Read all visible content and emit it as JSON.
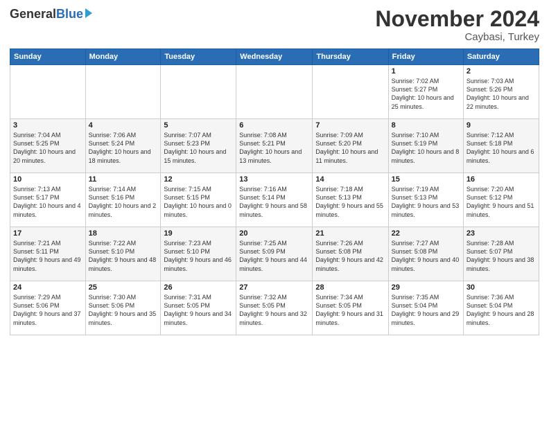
{
  "header": {
    "logo_general": "General",
    "logo_blue": "Blue",
    "month_title": "November 2024",
    "location": "Caybasi, Turkey"
  },
  "days_of_week": [
    "Sunday",
    "Monday",
    "Tuesday",
    "Wednesday",
    "Thursday",
    "Friday",
    "Saturday"
  ],
  "weeks": [
    [
      {
        "day": "",
        "info": ""
      },
      {
        "day": "",
        "info": ""
      },
      {
        "day": "",
        "info": ""
      },
      {
        "day": "",
        "info": ""
      },
      {
        "day": "",
        "info": ""
      },
      {
        "day": "1",
        "info": "Sunrise: 7:02 AM\nSunset: 5:27 PM\nDaylight: 10 hours and 25 minutes."
      },
      {
        "day": "2",
        "info": "Sunrise: 7:03 AM\nSunset: 5:26 PM\nDaylight: 10 hours and 22 minutes."
      }
    ],
    [
      {
        "day": "3",
        "info": "Sunrise: 7:04 AM\nSunset: 5:25 PM\nDaylight: 10 hours and 20 minutes."
      },
      {
        "day": "4",
        "info": "Sunrise: 7:06 AM\nSunset: 5:24 PM\nDaylight: 10 hours and 18 minutes."
      },
      {
        "day": "5",
        "info": "Sunrise: 7:07 AM\nSunset: 5:23 PM\nDaylight: 10 hours and 15 minutes."
      },
      {
        "day": "6",
        "info": "Sunrise: 7:08 AM\nSunset: 5:21 PM\nDaylight: 10 hours and 13 minutes."
      },
      {
        "day": "7",
        "info": "Sunrise: 7:09 AM\nSunset: 5:20 PM\nDaylight: 10 hours and 11 minutes."
      },
      {
        "day": "8",
        "info": "Sunrise: 7:10 AM\nSunset: 5:19 PM\nDaylight: 10 hours and 8 minutes."
      },
      {
        "day": "9",
        "info": "Sunrise: 7:12 AM\nSunset: 5:18 PM\nDaylight: 10 hours and 6 minutes."
      }
    ],
    [
      {
        "day": "10",
        "info": "Sunrise: 7:13 AM\nSunset: 5:17 PM\nDaylight: 10 hours and 4 minutes."
      },
      {
        "day": "11",
        "info": "Sunrise: 7:14 AM\nSunset: 5:16 PM\nDaylight: 10 hours and 2 minutes."
      },
      {
        "day": "12",
        "info": "Sunrise: 7:15 AM\nSunset: 5:15 PM\nDaylight: 10 hours and 0 minutes."
      },
      {
        "day": "13",
        "info": "Sunrise: 7:16 AM\nSunset: 5:14 PM\nDaylight: 9 hours and 58 minutes."
      },
      {
        "day": "14",
        "info": "Sunrise: 7:18 AM\nSunset: 5:13 PM\nDaylight: 9 hours and 55 minutes."
      },
      {
        "day": "15",
        "info": "Sunrise: 7:19 AM\nSunset: 5:13 PM\nDaylight: 9 hours and 53 minutes."
      },
      {
        "day": "16",
        "info": "Sunrise: 7:20 AM\nSunset: 5:12 PM\nDaylight: 9 hours and 51 minutes."
      }
    ],
    [
      {
        "day": "17",
        "info": "Sunrise: 7:21 AM\nSunset: 5:11 PM\nDaylight: 9 hours and 49 minutes."
      },
      {
        "day": "18",
        "info": "Sunrise: 7:22 AM\nSunset: 5:10 PM\nDaylight: 9 hours and 48 minutes."
      },
      {
        "day": "19",
        "info": "Sunrise: 7:23 AM\nSunset: 5:10 PM\nDaylight: 9 hours and 46 minutes."
      },
      {
        "day": "20",
        "info": "Sunrise: 7:25 AM\nSunset: 5:09 PM\nDaylight: 9 hours and 44 minutes."
      },
      {
        "day": "21",
        "info": "Sunrise: 7:26 AM\nSunset: 5:08 PM\nDaylight: 9 hours and 42 minutes."
      },
      {
        "day": "22",
        "info": "Sunrise: 7:27 AM\nSunset: 5:08 PM\nDaylight: 9 hours and 40 minutes."
      },
      {
        "day": "23",
        "info": "Sunrise: 7:28 AM\nSunset: 5:07 PM\nDaylight: 9 hours and 38 minutes."
      }
    ],
    [
      {
        "day": "24",
        "info": "Sunrise: 7:29 AM\nSunset: 5:06 PM\nDaylight: 9 hours and 37 minutes."
      },
      {
        "day": "25",
        "info": "Sunrise: 7:30 AM\nSunset: 5:06 PM\nDaylight: 9 hours and 35 minutes."
      },
      {
        "day": "26",
        "info": "Sunrise: 7:31 AM\nSunset: 5:05 PM\nDaylight: 9 hours and 34 minutes."
      },
      {
        "day": "27",
        "info": "Sunrise: 7:32 AM\nSunset: 5:05 PM\nDaylight: 9 hours and 32 minutes."
      },
      {
        "day": "28",
        "info": "Sunrise: 7:34 AM\nSunset: 5:05 PM\nDaylight: 9 hours and 31 minutes."
      },
      {
        "day": "29",
        "info": "Sunrise: 7:35 AM\nSunset: 5:04 PM\nDaylight: 9 hours and 29 minutes."
      },
      {
        "day": "30",
        "info": "Sunrise: 7:36 AM\nSunset: 5:04 PM\nDaylight: 9 hours and 28 minutes."
      }
    ]
  ]
}
